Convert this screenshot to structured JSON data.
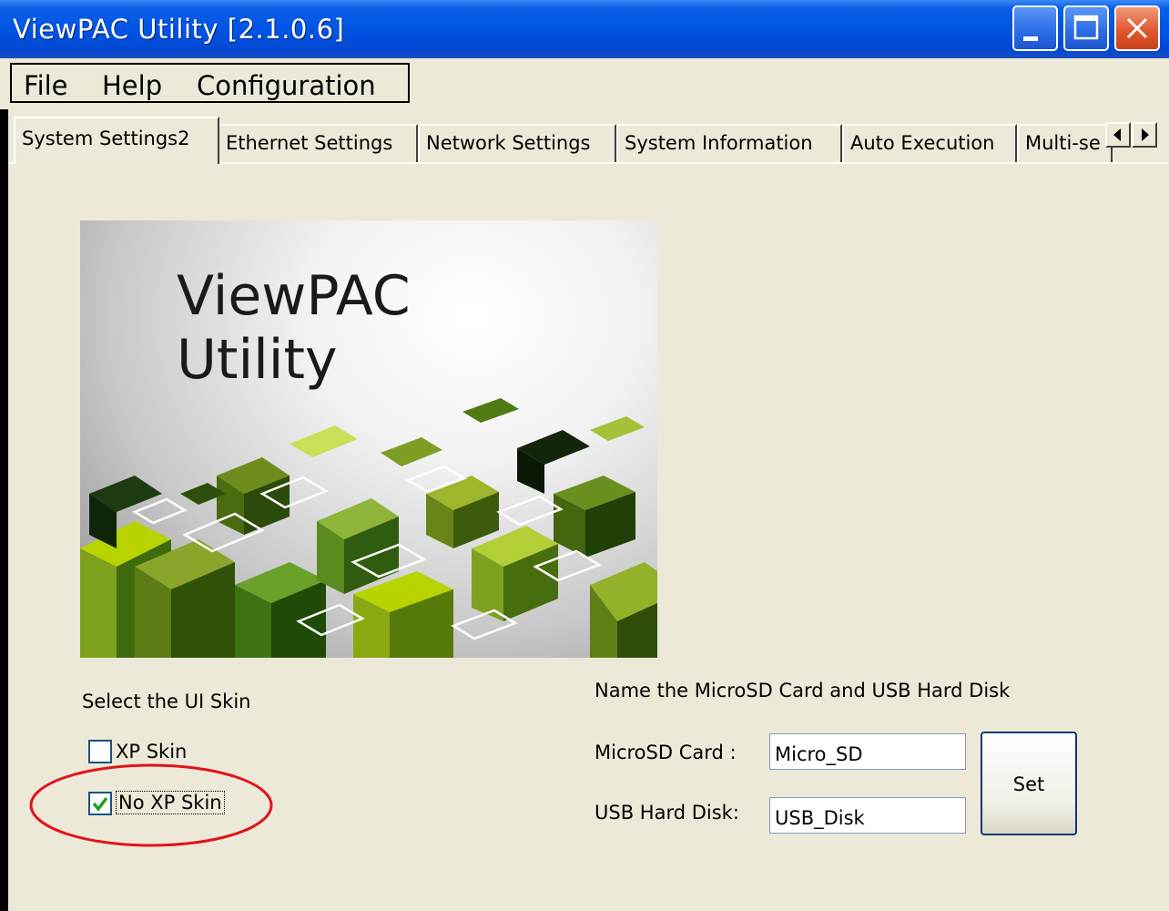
{
  "window": {
    "title": "ViewPAC Utility [2.1.0.6]",
    "buttons": [
      "minimize",
      "maximize",
      "close"
    ]
  },
  "menu": {
    "file": "File",
    "help": "Help",
    "configuration": "Configuration"
  },
  "tabs": [
    {
      "label": "System Settings2",
      "active": true
    },
    {
      "label": "Ethernet Settings",
      "active": false
    },
    {
      "label": "Network Settings",
      "active": false
    },
    {
      "label": "System Information",
      "active": false
    },
    {
      "label": "Auto Execution",
      "active": false
    },
    {
      "label": "Multi-se",
      "active": false
    }
  ],
  "banner": {
    "line1": "ViewPAC",
    "line2": "Utility"
  },
  "skin": {
    "heading": "Select the UI Skin",
    "options": [
      {
        "label": "XP Skin",
        "checked": false
      },
      {
        "label": "No XP Skin",
        "checked": true
      }
    ]
  },
  "storage": {
    "heading": "Name the MicroSD Card and USB Hard Disk",
    "microsd_label": "MicroSD Card :",
    "microsd_value": "Micro_SD",
    "usb_label": "USB Hard Disk:",
    "usb_value": "USB_Disk",
    "set_label": "Set"
  },
  "colors": {
    "titlebar": "#0054e3",
    "background": "#ece9d8",
    "highlight": "#e0141b",
    "checkmark": "#21a121"
  }
}
